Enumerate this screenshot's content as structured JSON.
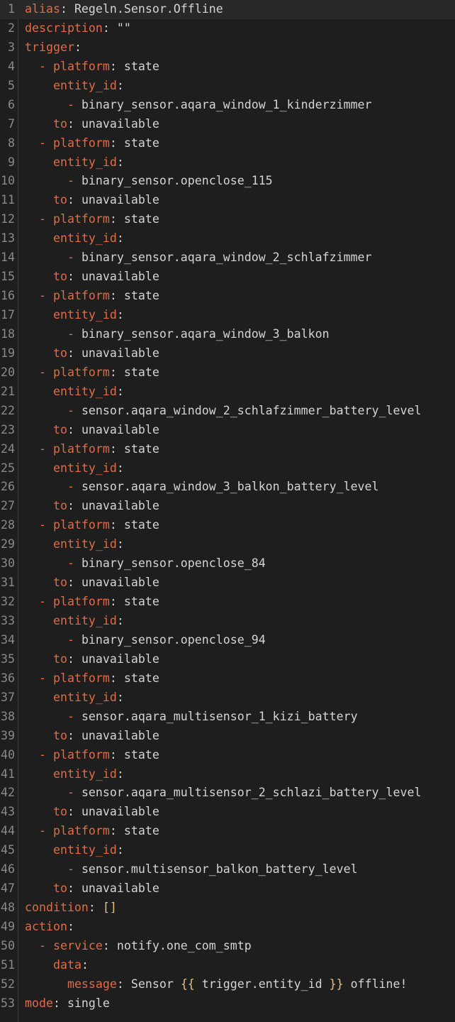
{
  "editor": {
    "lines": [
      {
        "n": "1",
        "indent": "",
        "tokens": [
          {
            "t": "alias",
            "c": "key"
          },
          {
            "t": ": ",
            "c": "plain"
          },
          {
            "t": "Regeln.Sensor.Offline",
            "c": "plain"
          }
        ]
      },
      {
        "n": "2",
        "indent": "",
        "tokens": [
          {
            "t": "description",
            "c": "key"
          },
          {
            "t": ": ",
            "c": "plain"
          },
          {
            "t": "\"\"",
            "c": "str"
          }
        ]
      },
      {
        "n": "3",
        "indent": "",
        "tokens": [
          {
            "t": "trigger",
            "c": "key"
          },
          {
            "t": ":",
            "c": "plain"
          }
        ]
      },
      {
        "n": "4",
        "indent": "  ",
        "tokens": [
          {
            "t": "- ",
            "c": "dash"
          },
          {
            "t": "platform",
            "c": "key"
          },
          {
            "t": ": ",
            "c": "plain"
          },
          {
            "t": "state",
            "c": "plain"
          }
        ]
      },
      {
        "n": "5",
        "indent": "    ",
        "tokens": [
          {
            "t": "entity_id",
            "c": "key"
          },
          {
            "t": ":",
            "c": "plain"
          }
        ]
      },
      {
        "n": "6",
        "indent": "      ",
        "tokens": [
          {
            "t": "- ",
            "c": "dash"
          },
          {
            "t": "binary_sensor.aqara_window_1_kinderzimmer",
            "c": "plain"
          }
        ]
      },
      {
        "n": "7",
        "indent": "    ",
        "tokens": [
          {
            "t": "to",
            "c": "key"
          },
          {
            "t": ": ",
            "c": "plain"
          },
          {
            "t": "unavailable",
            "c": "plain"
          }
        ]
      },
      {
        "n": "8",
        "indent": "  ",
        "tokens": [
          {
            "t": "- ",
            "c": "dash"
          },
          {
            "t": "platform",
            "c": "key"
          },
          {
            "t": ": ",
            "c": "plain"
          },
          {
            "t": "state",
            "c": "plain"
          }
        ]
      },
      {
        "n": "9",
        "indent": "    ",
        "tokens": [
          {
            "t": "entity_id",
            "c": "key"
          },
          {
            "t": ":",
            "c": "plain"
          }
        ]
      },
      {
        "n": "10",
        "indent": "      ",
        "tokens": [
          {
            "t": "- ",
            "c": "dash"
          },
          {
            "t": "binary_sensor.openclose_115",
            "c": "plain"
          }
        ]
      },
      {
        "n": "11",
        "indent": "    ",
        "tokens": [
          {
            "t": "to",
            "c": "key"
          },
          {
            "t": ": ",
            "c": "plain"
          },
          {
            "t": "unavailable",
            "c": "plain"
          }
        ]
      },
      {
        "n": "12",
        "indent": "  ",
        "tokens": [
          {
            "t": "- ",
            "c": "dash"
          },
          {
            "t": "platform",
            "c": "key"
          },
          {
            "t": ": ",
            "c": "plain"
          },
          {
            "t": "state",
            "c": "plain"
          }
        ]
      },
      {
        "n": "13",
        "indent": "    ",
        "tokens": [
          {
            "t": "entity_id",
            "c": "key"
          },
          {
            "t": ":",
            "c": "plain"
          }
        ]
      },
      {
        "n": "14",
        "indent": "      ",
        "tokens": [
          {
            "t": "- ",
            "c": "dash"
          },
          {
            "t": "binary_sensor.aqara_window_2_schlafzimmer",
            "c": "plain"
          }
        ]
      },
      {
        "n": "15",
        "indent": "    ",
        "tokens": [
          {
            "t": "to",
            "c": "key"
          },
          {
            "t": ": ",
            "c": "plain"
          },
          {
            "t": "unavailable",
            "c": "plain"
          }
        ]
      },
      {
        "n": "16",
        "indent": "  ",
        "tokens": [
          {
            "t": "- ",
            "c": "dash"
          },
          {
            "t": "platform",
            "c": "key"
          },
          {
            "t": ": ",
            "c": "plain"
          },
          {
            "t": "state",
            "c": "plain"
          }
        ]
      },
      {
        "n": "17",
        "indent": "    ",
        "tokens": [
          {
            "t": "entity_id",
            "c": "key"
          },
          {
            "t": ":",
            "c": "plain"
          }
        ]
      },
      {
        "n": "18",
        "indent": "      ",
        "tokens": [
          {
            "t": "- ",
            "c": "dash"
          },
          {
            "t": "binary_sensor.aqara_window_3_balkon",
            "c": "plain"
          }
        ]
      },
      {
        "n": "19",
        "indent": "    ",
        "tokens": [
          {
            "t": "to",
            "c": "key"
          },
          {
            "t": ": ",
            "c": "plain"
          },
          {
            "t": "unavailable",
            "c": "plain"
          }
        ]
      },
      {
        "n": "20",
        "indent": "  ",
        "tokens": [
          {
            "t": "- ",
            "c": "dash"
          },
          {
            "t": "platform",
            "c": "key"
          },
          {
            "t": ": ",
            "c": "plain"
          },
          {
            "t": "state",
            "c": "plain"
          }
        ]
      },
      {
        "n": "21",
        "indent": "    ",
        "tokens": [
          {
            "t": "entity_id",
            "c": "key"
          },
          {
            "t": ":",
            "c": "plain"
          }
        ]
      },
      {
        "n": "22",
        "indent": "      ",
        "tokens": [
          {
            "t": "- ",
            "c": "dash"
          },
          {
            "t": "sensor.aqara_window_2_schlafzimmer_battery_level",
            "c": "plain"
          }
        ]
      },
      {
        "n": "23",
        "indent": "    ",
        "tokens": [
          {
            "t": "to",
            "c": "key"
          },
          {
            "t": ": ",
            "c": "plain"
          },
          {
            "t": "unavailable",
            "c": "plain"
          }
        ]
      },
      {
        "n": "24",
        "indent": "  ",
        "tokens": [
          {
            "t": "- ",
            "c": "dash"
          },
          {
            "t": "platform",
            "c": "key"
          },
          {
            "t": ": ",
            "c": "plain"
          },
          {
            "t": "state",
            "c": "plain"
          }
        ]
      },
      {
        "n": "25",
        "indent": "    ",
        "tokens": [
          {
            "t": "entity_id",
            "c": "key"
          },
          {
            "t": ":",
            "c": "plain"
          }
        ]
      },
      {
        "n": "26",
        "indent": "      ",
        "tokens": [
          {
            "t": "- ",
            "c": "dash"
          },
          {
            "t": "sensor.aqara_window_3_balkon_battery_level",
            "c": "plain"
          }
        ]
      },
      {
        "n": "27",
        "indent": "    ",
        "tokens": [
          {
            "t": "to",
            "c": "key"
          },
          {
            "t": ": ",
            "c": "plain"
          },
          {
            "t": "unavailable",
            "c": "plain"
          }
        ]
      },
      {
        "n": "28",
        "indent": "  ",
        "tokens": [
          {
            "t": "- ",
            "c": "dash"
          },
          {
            "t": "platform",
            "c": "key"
          },
          {
            "t": ": ",
            "c": "plain"
          },
          {
            "t": "state",
            "c": "plain"
          }
        ]
      },
      {
        "n": "29",
        "indent": "    ",
        "tokens": [
          {
            "t": "entity_id",
            "c": "key"
          },
          {
            "t": ":",
            "c": "plain"
          }
        ]
      },
      {
        "n": "30",
        "indent": "      ",
        "tokens": [
          {
            "t": "- ",
            "c": "dash"
          },
          {
            "t": "binary_sensor.openclose_84",
            "c": "plain"
          }
        ]
      },
      {
        "n": "31",
        "indent": "    ",
        "tokens": [
          {
            "t": "to",
            "c": "key"
          },
          {
            "t": ": ",
            "c": "plain"
          },
          {
            "t": "unavailable",
            "c": "plain"
          }
        ]
      },
      {
        "n": "32",
        "indent": "  ",
        "tokens": [
          {
            "t": "- ",
            "c": "dash"
          },
          {
            "t": "platform",
            "c": "key"
          },
          {
            "t": ": ",
            "c": "plain"
          },
          {
            "t": "state",
            "c": "plain"
          }
        ]
      },
      {
        "n": "33",
        "indent": "    ",
        "tokens": [
          {
            "t": "entity_id",
            "c": "key"
          },
          {
            "t": ":",
            "c": "plain"
          }
        ]
      },
      {
        "n": "34",
        "indent": "      ",
        "tokens": [
          {
            "t": "- ",
            "c": "dash"
          },
          {
            "t": "binary_sensor.openclose_94",
            "c": "plain"
          }
        ]
      },
      {
        "n": "35",
        "indent": "    ",
        "tokens": [
          {
            "t": "to",
            "c": "key"
          },
          {
            "t": ": ",
            "c": "plain"
          },
          {
            "t": "unavailable",
            "c": "plain"
          }
        ]
      },
      {
        "n": "36",
        "indent": "  ",
        "tokens": [
          {
            "t": "- ",
            "c": "dash"
          },
          {
            "t": "platform",
            "c": "key"
          },
          {
            "t": ": ",
            "c": "plain"
          },
          {
            "t": "state",
            "c": "plain"
          }
        ]
      },
      {
        "n": "37",
        "indent": "    ",
        "tokens": [
          {
            "t": "entity_id",
            "c": "key"
          },
          {
            "t": ":",
            "c": "plain"
          }
        ]
      },
      {
        "n": "38",
        "indent": "      ",
        "tokens": [
          {
            "t": "- ",
            "c": "dash"
          },
          {
            "t": "sensor.aqara_multisensor_1_kizi_battery",
            "c": "plain"
          }
        ]
      },
      {
        "n": "39",
        "indent": "    ",
        "tokens": [
          {
            "t": "to",
            "c": "key"
          },
          {
            "t": ": ",
            "c": "plain"
          },
          {
            "t": "unavailable",
            "c": "plain"
          }
        ]
      },
      {
        "n": "40",
        "indent": "  ",
        "tokens": [
          {
            "t": "- ",
            "c": "dash"
          },
          {
            "t": "platform",
            "c": "key"
          },
          {
            "t": ": ",
            "c": "plain"
          },
          {
            "t": "state",
            "c": "plain"
          }
        ]
      },
      {
        "n": "41",
        "indent": "    ",
        "tokens": [
          {
            "t": "entity_id",
            "c": "key"
          },
          {
            "t": ":",
            "c": "plain"
          }
        ]
      },
      {
        "n": "42",
        "indent": "      ",
        "tokens": [
          {
            "t": "- ",
            "c": "dash"
          },
          {
            "t": "sensor.aqara_multisensor_2_schlazi_battery_level",
            "c": "plain"
          }
        ]
      },
      {
        "n": "43",
        "indent": "    ",
        "tokens": [
          {
            "t": "to",
            "c": "key"
          },
          {
            "t": ": ",
            "c": "plain"
          },
          {
            "t": "unavailable",
            "c": "plain"
          }
        ]
      },
      {
        "n": "44",
        "indent": "  ",
        "tokens": [
          {
            "t": "- ",
            "c": "dash"
          },
          {
            "t": "platform",
            "c": "key"
          },
          {
            "t": ": ",
            "c": "plain"
          },
          {
            "t": "state",
            "c": "plain"
          }
        ]
      },
      {
        "n": "45",
        "indent": "    ",
        "tokens": [
          {
            "t": "entity_id",
            "c": "key"
          },
          {
            "t": ":",
            "c": "plain"
          }
        ]
      },
      {
        "n": "46",
        "indent": "      ",
        "tokens": [
          {
            "t": "- ",
            "c": "dash"
          },
          {
            "t": "sensor.multisensor_balkon_battery_level",
            "c": "plain"
          }
        ]
      },
      {
        "n": "47",
        "indent": "    ",
        "tokens": [
          {
            "t": "to",
            "c": "key"
          },
          {
            "t": ": ",
            "c": "plain"
          },
          {
            "t": "unavailable",
            "c": "plain"
          }
        ]
      },
      {
        "n": "48",
        "indent": "",
        "tokens": [
          {
            "t": "condition",
            "c": "key"
          },
          {
            "t": ": ",
            "c": "plain"
          },
          {
            "t": "[]",
            "c": "bracket"
          }
        ]
      },
      {
        "n": "49",
        "indent": "",
        "tokens": [
          {
            "t": "action",
            "c": "key"
          },
          {
            "t": ":",
            "c": "plain"
          }
        ]
      },
      {
        "n": "50",
        "indent": "  ",
        "tokens": [
          {
            "t": "- ",
            "c": "dash"
          },
          {
            "t": "service",
            "c": "key"
          },
          {
            "t": ": ",
            "c": "plain"
          },
          {
            "t": "notify.one_com_smtp",
            "c": "plain"
          }
        ]
      },
      {
        "n": "51",
        "indent": "    ",
        "tokens": [
          {
            "t": "data",
            "c": "key"
          },
          {
            "t": ":",
            "c": "plain"
          }
        ]
      },
      {
        "n": "52",
        "indent": "      ",
        "tokens": [
          {
            "t": "message",
            "c": "key"
          },
          {
            "t": ": ",
            "c": "plain"
          },
          {
            "t": "Sensor ",
            "c": "plain"
          },
          {
            "t": "{{",
            "c": "bracket"
          },
          {
            "t": " trigger.entity_id ",
            "c": "plain"
          },
          {
            "t": "}}",
            "c": "bracket"
          },
          {
            "t": " offline!",
            "c": "plain"
          }
        ]
      },
      {
        "n": "53",
        "indent": "",
        "tokens": [
          {
            "t": "mode",
            "c": "key"
          },
          {
            "t": ": ",
            "c": "plain"
          },
          {
            "t": "single",
            "c": "plain"
          }
        ]
      }
    ],
    "current_line": "1",
    "colors": {
      "background": "#1e1e1e",
      "key": "#e06c45",
      "text": "#d4d4d4",
      "bracket": "#e5c07b",
      "line_number": "#8a8a8a"
    }
  }
}
